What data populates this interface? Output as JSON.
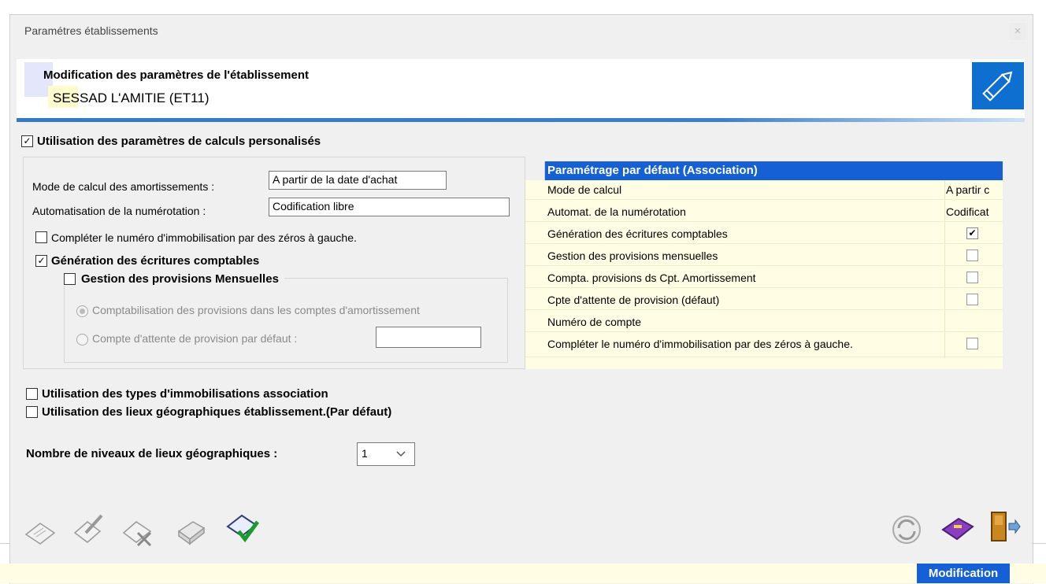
{
  "window": {
    "title": "Paramétres établissements"
  },
  "header": {
    "title": "Modification des paramètres de l'établissement",
    "subtitle": "SESSAD L'AMITIE (ET11)"
  },
  "main": {
    "custom_params": {
      "label": "Utilisation des paramètres de calculs personalisés",
      "checked": true
    },
    "amort_mode": {
      "label": "Mode de calcul des amortissements :",
      "value": "A partir de la date d'achat"
    },
    "numbering": {
      "label": "Automatisation de la numérotation :",
      "value": "Codification libre"
    },
    "zeros": {
      "label": "Compléter le numéro d'immobilisation par des zéros à gauche.",
      "checked": false
    },
    "accounting": {
      "label": "Génération des écritures comptables",
      "checked": true
    },
    "monthly_provisions": {
      "label": "Gestion des provisions Mensuelles",
      "checked": false
    },
    "radio_amort": {
      "label": "Comptabilisation des provisions dans les comptes d'amortissement",
      "selected": true
    },
    "radio_pending": {
      "label": "Compte d'attente de provision par défaut :",
      "selected": false,
      "value": ""
    },
    "asset_types": {
      "label": "Utilisation des types d'immobilisations association",
      "checked": false
    },
    "geo_places": {
      "label": "Utilisation des lieux géographiques établissement.(Par défaut)",
      "checked": false
    },
    "geo_levels": {
      "label": "Nombre de niveaux de lieux géographiques :",
      "value": "1"
    }
  },
  "defaults_grid": {
    "header": "Paramétrage par défaut (Association)",
    "rows": [
      {
        "label": "Mode de calcul",
        "value": "A partir c"
      },
      {
        "label": "Automat. de la numérotation",
        "value": "Codificat"
      },
      {
        "label": "Génération des écritures comptables",
        "check": true
      },
      {
        "label": "Gestion des provisions mensuelles",
        "check": false
      },
      {
        "label": "Compta. provisions ds Cpt. Amortissement",
        "check": false
      },
      {
        "label": "Cpte d'attente de provision (défaut)",
        "check": false
      },
      {
        "label": "Numéro de compte",
        "value": ""
      },
      {
        "label": "Compléter le numéro d'immobilisation par des zéros à gauche.",
        "check": false
      }
    ]
  },
  "toolbar": {
    "left_icons": [
      "add-sheet-icon",
      "edit-sheet-icon",
      "delete-sheet-icon",
      "archive-icon",
      "validate-icon"
    ],
    "right_icons": [
      "refresh-icon",
      "key-folder-icon",
      "exit-door-icon"
    ]
  },
  "status": {
    "mode": "Modification"
  },
  "colors": {
    "accent": "#1560d4",
    "grid_bg": "#fffde3",
    "window_bg": "#f0f0f0"
  }
}
